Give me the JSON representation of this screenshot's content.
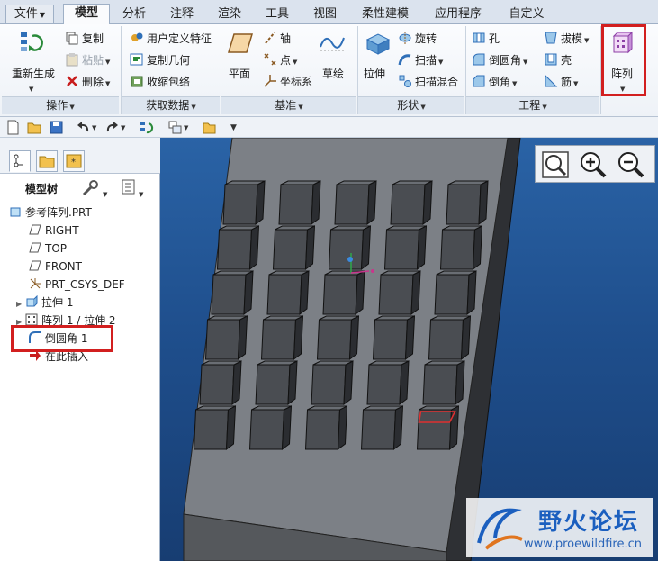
{
  "tabs": [
    {
      "label": "文件",
      "has_caret": true
    },
    {
      "label": "模型",
      "active": true
    },
    {
      "label": "分析"
    },
    {
      "label": "注释"
    },
    {
      "label": "渲染"
    },
    {
      "label": "工具"
    },
    {
      "label": "视图"
    },
    {
      "label": "柔性建模"
    },
    {
      "label": "应用程序"
    },
    {
      "label": "自定义"
    }
  ],
  "ribbon": {
    "operations": {
      "regenerate": "重新生成",
      "copy": "复制",
      "paste": "粘贴",
      "delete": "删除",
      "group": "操作"
    },
    "get_data": {
      "user_feature": "用户定义特征",
      "copy_geometry": "复制几何",
      "shrinkwrap": "收缩包络",
      "group": "获取数据"
    },
    "datum": {
      "plane": "平面",
      "axis": "轴",
      "point": "点",
      "csys": "坐标系",
      "sketch": "草绘",
      "group": "基准"
    },
    "shapes": {
      "extrude": "拉伸",
      "revolve": "旋转",
      "sweep": "扫描",
      "swept_blend": "扫描混合",
      "group": "形状"
    },
    "engineering": {
      "hole": "孔",
      "round": "倒圆角",
      "chamfer": "倒角",
      "draft": "拔模",
      "shell": "壳",
      "rib": "筋",
      "group": "工程"
    },
    "pattern": {
      "label": "阵列"
    }
  },
  "model_tree": {
    "header": "模型树",
    "items": [
      {
        "label": "参考阵列.PRT",
        "icon": "part-icon",
        "indent": 0
      },
      {
        "label": "RIGHT",
        "icon": "datum-plane-icon",
        "indent": 1
      },
      {
        "label": "TOP",
        "icon": "datum-plane-icon",
        "indent": 1
      },
      {
        "label": "FRONT",
        "icon": "datum-plane-icon",
        "indent": 1
      },
      {
        "label": "PRT_CSYS_DEF",
        "icon": "csys-icon",
        "indent": 1
      },
      {
        "label": "拉伸 1",
        "icon": "extrude-icon",
        "indent": 1,
        "expandable": true
      },
      {
        "label": "阵列 1 / 拉伸 2",
        "icon": "pattern-icon",
        "indent": 1,
        "expandable": true
      },
      {
        "label": "倒圆角 1",
        "icon": "round-icon",
        "indent": 1,
        "highlighted": true
      },
      {
        "label": "在此插入",
        "icon": "insert-arrow-icon",
        "indent": 1
      }
    ]
  },
  "watermark": {
    "title": "野火论坛",
    "url": "www.proewildfire.cn"
  },
  "colors": {
    "highlight_red": "#d21f1f",
    "viewport_top": "#2a63a6",
    "viewport_bottom": "#173d72"
  }
}
